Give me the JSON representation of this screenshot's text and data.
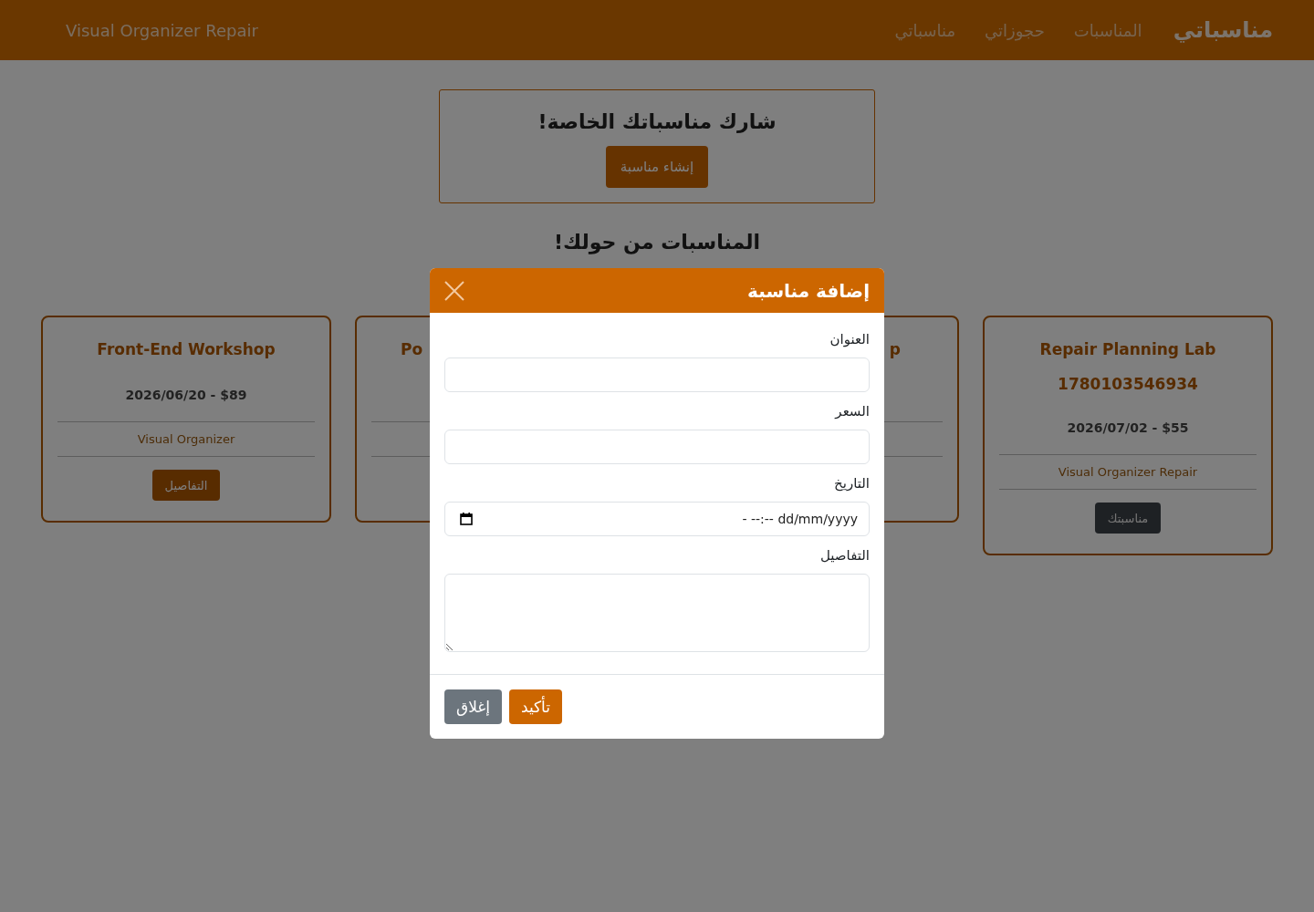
{
  "navbar": {
    "brand": "مناسباتي",
    "links": [
      {
        "label": "المناسبات"
      },
      {
        "label": "حجوزاتي"
      },
      {
        "label": "مناسباتي"
      }
    ],
    "site_name": "Visual Organizer Repair"
  },
  "hero": {
    "title": "شارك مناسباتك الخاصة!",
    "button": "إنشاء مناسبة"
  },
  "section_title": "المناسبات من حولك!",
  "cards": [
    {
      "kind": "full",
      "title": "Repair Planning Lab",
      "code": "1780103546934",
      "date_price": "2026/07/02 - $55",
      "organizer": "Visual Organizer Repair",
      "button": {
        "label": "مناسبتك",
        "kind": "owner"
      }
    },
    {
      "kind": "tail",
      "title": "p"
    },
    {
      "kind": "head",
      "title": "Po"
    },
    {
      "kind": "full",
      "title": "Front-End Workshop",
      "date_price": "2026/06/20 - $89",
      "organizer": "Visual Organizer",
      "button": {
        "label": "التفاصيل",
        "kind": "details"
      }
    }
  ],
  "modal": {
    "title": "إضافة مناسبة",
    "fields": [
      {
        "label": "العنوان",
        "kind": "text"
      },
      {
        "label": "السعر",
        "kind": "text"
      },
      {
        "label": "التاريخ",
        "kind": "datetime",
        "placeholder": "- --:-- dd/mm/yyyy"
      },
      {
        "label": "التفاصيل",
        "kind": "textarea"
      }
    ],
    "buttons": [
      {
        "label": "تأكيد",
        "kind": "primary"
      },
      {
        "label": "إغلاق",
        "kind": "secondary"
      }
    ]
  }
}
